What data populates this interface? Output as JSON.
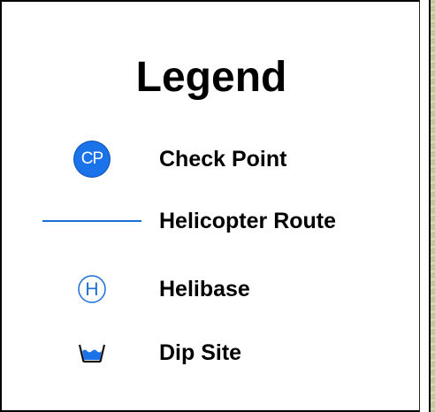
{
  "legend": {
    "title": "Legend",
    "items": [
      {
        "symbol": "checkpoint-circle-icon",
        "symbol_text": "CP",
        "label": "Check Point",
        "color": "#1a73e8"
      },
      {
        "symbol": "helicopter-route-line",
        "label": "Helicopter Route",
        "color": "#1a6fd6"
      },
      {
        "symbol": "helibase-icon",
        "symbol_text": "H",
        "label": "Helibase",
        "color": "#1a6fd6"
      },
      {
        "symbol": "dip-site-icon",
        "label": "Dip Site",
        "color": "#1a73e8"
      }
    ]
  }
}
